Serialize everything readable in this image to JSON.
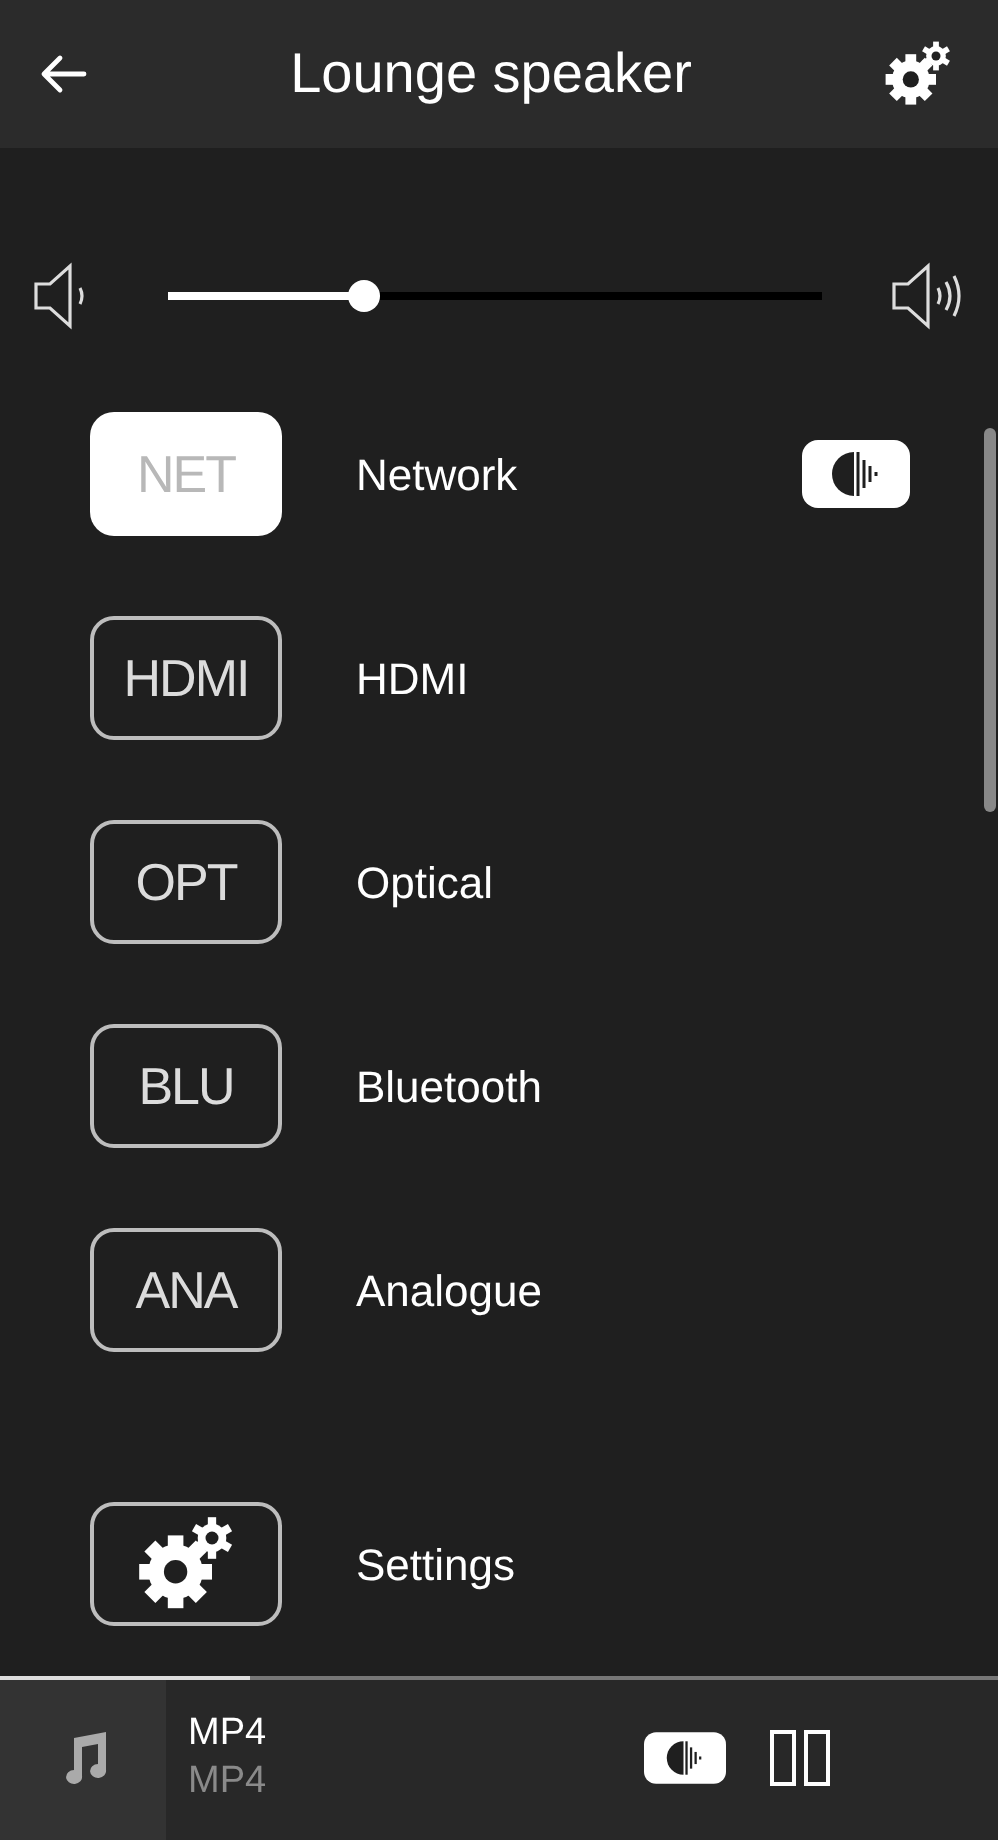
{
  "header": {
    "title": "Lounge speaker"
  },
  "volume": {
    "level": 0.3
  },
  "sources": [
    {
      "kind": "source",
      "badge": "NET",
      "label": "Network",
      "selected": true,
      "playing": true
    },
    {
      "kind": "source",
      "badge": "HDMI",
      "label": "HDMI",
      "selected": false,
      "playing": false
    },
    {
      "kind": "source",
      "badge": "OPT",
      "label": "Optical",
      "selected": false,
      "playing": false
    },
    {
      "kind": "source",
      "badge": "BLU",
      "label": "Bluetooth",
      "selected": false,
      "playing": false
    },
    {
      "kind": "source",
      "badge": "ANA",
      "label": "Analogue",
      "selected": false,
      "playing": false
    },
    {
      "kind": "settings",
      "label": "Settings",
      "selected": false,
      "playing": false
    }
  ],
  "player": {
    "title": "MP4",
    "subtitle": "MP4",
    "level": 0.25
  }
}
